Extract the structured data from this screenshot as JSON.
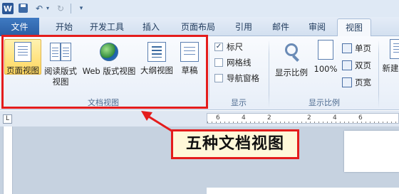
{
  "qat": {
    "logo_letter": "W",
    "icons": [
      "save-icon",
      "undo-icon",
      "redo-icon",
      "customize-icon"
    ]
  },
  "tabs": {
    "file": "文件",
    "items": [
      "开始",
      "开发工具",
      "插入",
      "页面布局",
      "引用",
      "邮件",
      "审阅",
      "视图"
    ],
    "active": "视图"
  },
  "ribbon": {
    "doc_views": {
      "buttons": [
        {
          "label": "页面视图",
          "icon": "print-layout-icon",
          "selected": true
        },
        {
          "label": "阅读版式\n视图",
          "icon": "reading-layout-icon",
          "selected": false
        },
        {
          "label": "Web 版式视图",
          "icon": "web-layout-icon",
          "selected": false
        },
        {
          "label": "大纲视图",
          "icon": "outline-icon",
          "selected": false
        },
        {
          "label": "草稿",
          "icon": "draft-icon",
          "selected": false
        }
      ],
      "group_label": "文档视图"
    },
    "show": {
      "checkboxes": [
        {
          "label": "标尺",
          "checked": true
        },
        {
          "label": "网格线",
          "checked": false
        },
        {
          "label": "导航窗格",
          "checked": false
        }
      ],
      "group_label": "显示"
    },
    "zoom": {
      "zoom_label": "显示比例",
      "percent_label": "100%",
      "one_page": "单页",
      "two_pages": "双页",
      "page_width": "页宽",
      "group_label": "显示比例"
    },
    "new_window_partial": "新建"
  },
  "ruler": {
    "corner": "L",
    "numbers": [
      "6",
      "4",
      "2",
      "2",
      "4",
      "6"
    ]
  },
  "callout": {
    "text": "五种文档视图"
  },
  "colors": {
    "highlight": "#e41c1c",
    "file_tab": "#2a5ea3",
    "selected_button": "#ffd75e"
  }
}
